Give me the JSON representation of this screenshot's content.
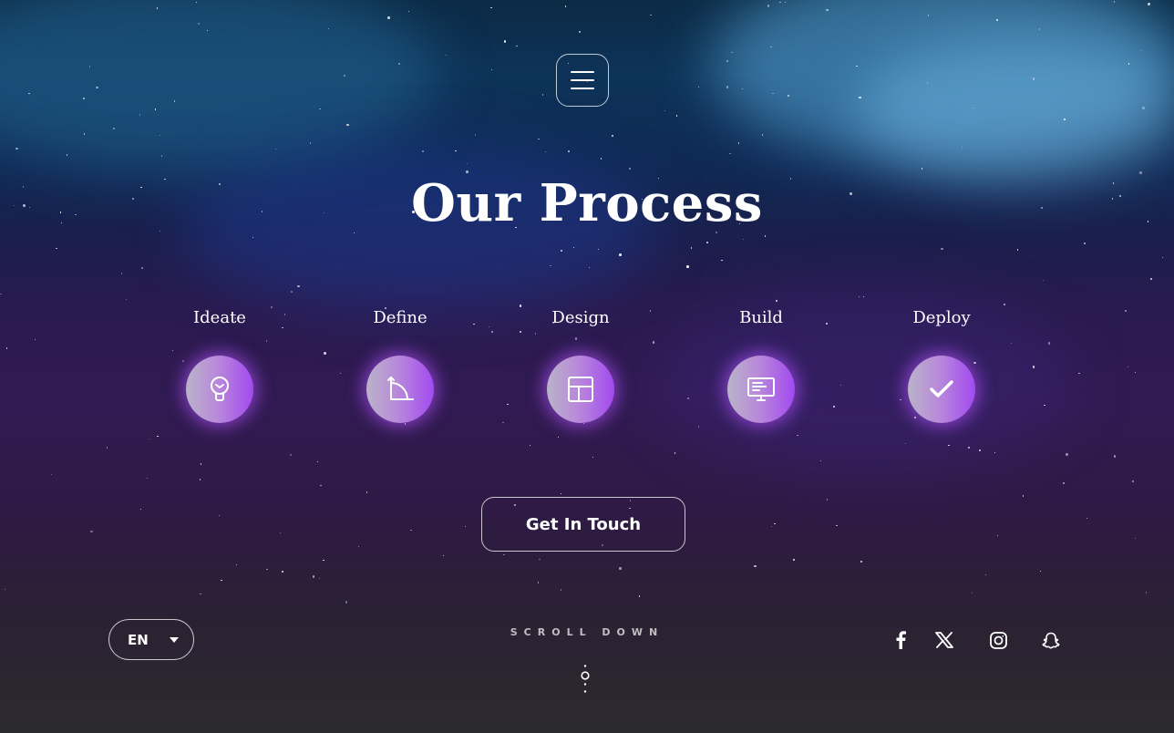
{
  "header": {
    "menu_icon": "hamburger-icon"
  },
  "page": {
    "title": "Our Process"
  },
  "steps": [
    {
      "label": "Ideate",
      "icon": "lightbulb-icon"
    },
    {
      "label": "Define",
      "icon": "curve-ruler-icon"
    },
    {
      "label": "Design",
      "icon": "layout-icon"
    },
    {
      "label": "Build",
      "icon": "monitor-code-icon"
    },
    {
      "label": "Deploy",
      "icon": "checkmark-icon"
    }
  ],
  "cta": {
    "label": "Get In Touch"
  },
  "footer": {
    "language": "EN",
    "scroll_label": "SCROLL DOWN",
    "social": [
      "facebook-icon",
      "x-icon",
      "instagram-icon",
      "snapchat-icon"
    ]
  },
  "colors": {
    "accent": "#a24af0",
    "glow": "#b252ff"
  }
}
